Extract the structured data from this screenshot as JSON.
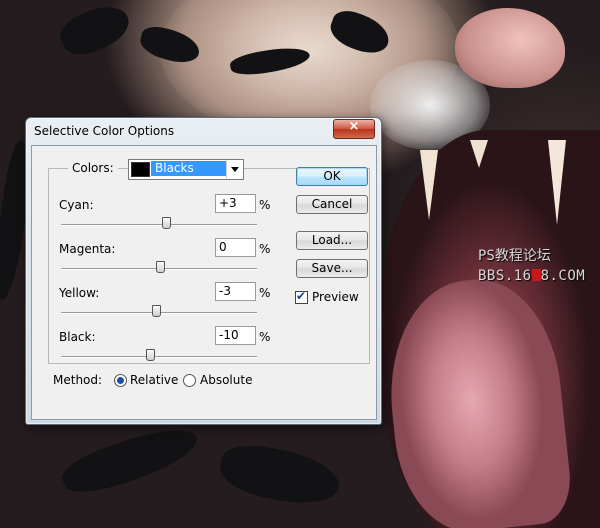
{
  "dialog": {
    "title": "Selective Color Options",
    "close_label": "×"
  },
  "colors": {
    "label": "Colors:",
    "selected": "Blacks",
    "swatch_color": "#000000"
  },
  "adjustments": [
    {
      "label": "Cyan:",
      "value": "+3",
      "unit": "%",
      "level": 0.53
    },
    {
      "label": "Magenta:",
      "value": "0",
      "unit": "%",
      "level": 0.5
    },
    {
      "label": "Yellow:",
      "value": "-3",
      "unit": "%",
      "level": 0.48
    },
    {
      "label": "Black:",
      "value": "-10",
      "unit": "%",
      "level": 0.45
    }
  ],
  "buttons": {
    "ok": "OK",
    "cancel": "Cancel",
    "load": "Load...",
    "save": "Save..."
  },
  "preview": {
    "label": "Preview",
    "checked": true
  },
  "method": {
    "label": "Method:",
    "options": [
      {
        "label": "Relative",
        "selected": true
      },
      {
        "label": "Absolute",
        "selected": false
      }
    ]
  },
  "watermark": {
    "line1": "PS教程论坛",
    "line2_prefix": "BBS.16",
    "line2_suffix": "8.COM"
  },
  "colors_palette": {
    "selection_blue": "#3399ff",
    "close_red": "#c8452c",
    "default_button_blue": "#3c7fb1"
  }
}
